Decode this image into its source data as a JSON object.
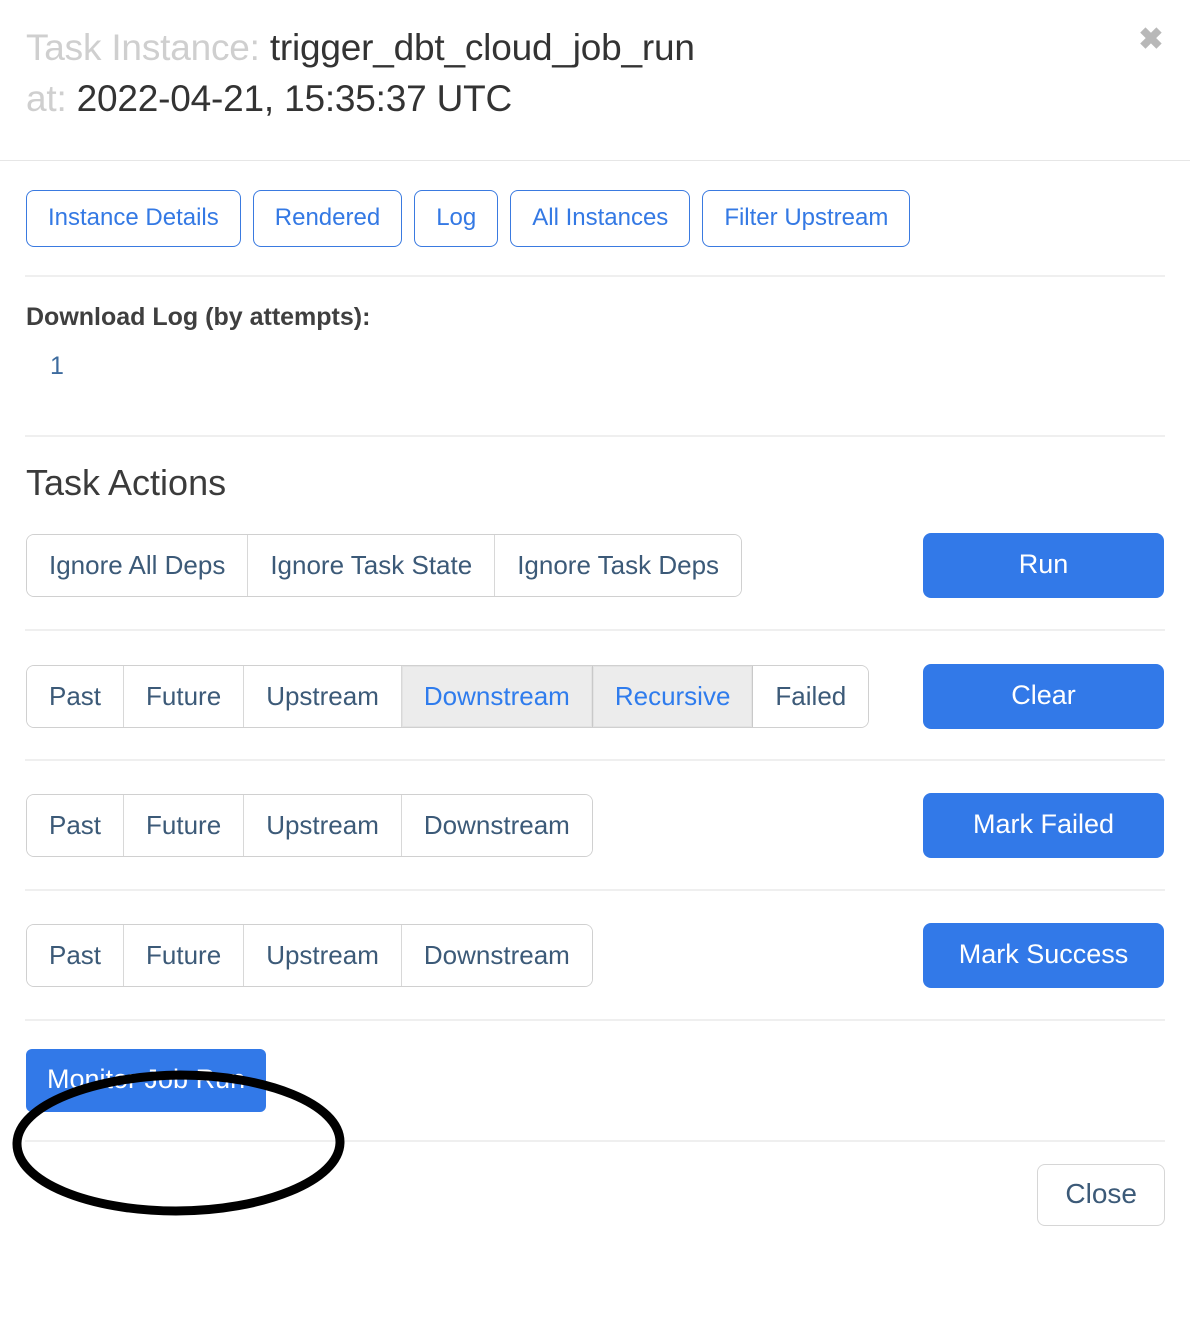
{
  "header": {
    "label_task_instance": "Task Instance:",
    "task_id": "trigger_dbt_cloud_job_run",
    "label_at": "at:",
    "execution_date": "2022-04-21, 15:35:37 UTC",
    "close_icon": "close-x-icon",
    "close_glyph": "✖"
  },
  "nav_links": [
    {
      "label": "Instance Details"
    },
    {
      "label": "Rendered"
    },
    {
      "label": "Log"
    },
    {
      "label": "All Instances"
    },
    {
      "label": "Filter Upstream"
    }
  ],
  "download_log": {
    "label": "Download Log (by attempts):",
    "attempts": [
      "1"
    ]
  },
  "task_actions": {
    "heading": "Task Actions",
    "rows": [
      {
        "name": "run",
        "toggles": [
          {
            "label": "Ignore All Deps",
            "active": false
          },
          {
            "label": "Ignore Task State",
            "active": false
          },
          {
            "label": "Ignore Task Deps",
            "active": false
          }
        ],
        "action_label": "Run"
      },
      {
        "name": "clear",
        "toggles": [
          {
            "label": "Past",
            "active": false
          },
          {
            "label": "Future",
            "active": false
          },
          {
            "label": "Upstream",
            "active": false
          },
          {
            "label": "Downstream",
            "active": true
          },
          {
            "label": "Recursive",
            "active": true
          },
          {
            "label": "Failed",
            "active": false
          }
        ],
        "action_label": "Clear"
      },
      {
        "name": "mark-failed",
        "toggles": [
          {
            "label": "Past",
            "active": false
          },
          {
            "label": "Future",
            "active": false
          },
          {
            "label": "Upstream",
            "active": false
          },
          {
            "label": "Downstream",
            "active": false
          }
        ],
        "action_label": "Mark Failed"
      },
      {
        "name": "mark-success",
        "toggles": [
          {
            "label": "Past",
            "active": false
          },
          {
            "label": "Future",
            "active": false
          },
          {
            "label": "Upstream",
            "active": false
          },
          {
            "label": "Downstream",
            "active": false
          }
        ],
        "action_label": "Mark Success"
      }
    ],
    "monitor_label": "Monitor Job Run"
  },
  "footer": {
    "close_label": "Close"
  },
  "annotation": {
    "shape": "ellipse-highlight",
    "target": "Monitor Job Run",
    "color": "#000000"
  },
  "colors": {
    "primary_blue": "#3279e8",
    "link_blue": "#3479e4",
    "toggle_text": "#3c5a78",
    "active_toggle_bg": "#ececec",
    "active_toggle_text": "#2f7ced",
    "muted_title": "#cfcfcf",
    "divider": "#eeeeee",
    "annotation": "#000000"
  }
}
